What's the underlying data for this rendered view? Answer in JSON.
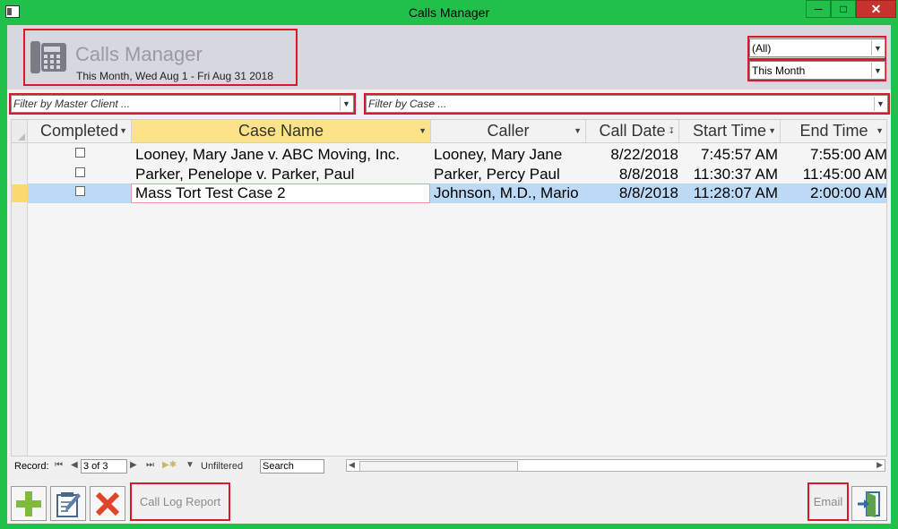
{
  "window": {
    "title": "Calls Manager",
    "minimize_icon": "minimize-icon",
    "maximize_icon": "maximize-icon",
    "close_icon": "close-icon"
  },
  "header": {
    "title": "Calls Manager",
    "subtitle": "This Month, Wed Aug 1 - Fri Aug 31 2018",
    "icon": "phone-icon",
    "status_filter": "(All)",
    "period_filter": "This Month"
  },
  "filters": {
    "master_client_placeholder": "Filter by Master Client ...",
    "case_placeholder": "Filter by Case ..."
  },
  "table": {
    "columns": [
      "Completed",
      "Case Name",
      "Caller",
      "Call Date",
      "Start Time",
      "End Time"
    ],
    "rows": [
      {
        "completed": false,
        "case_name": "Looney, Mary Jane v. ABC Moving, Inc.",
        "caller": "Looney, Mary  Jane",
        "call_date": "8/22/2018",
        "start_time": "7:45:57 AM",
        "end_time": "7:55:00 AM"
      },
      {
        "completed": false,
        "case_name": "Parker, Penelope v. Parker, Paul",
        "caller": "Parker, Percy Paul",
        "call_date": "8/8/2018",
        "start_time": "11:30:37 AM",
        "end_time": "11:45:00 AM"
      },
      {
        "completed": false,
        "case_name": "Mass Tort Test Case 2",
        "caller": "Johnson, M.D., Mario",
        "call_date": "8/8/2018",
        "start_time": "11:28:07 AM",
        "end_time": "2:00:00 AM"
      }
    ]
  },
  "navigation": {
    "record_label": "Record:",
    "record_position": "3 of 3",
    "filter_status": "Unfiltered",
    "search_label": "Search"
  },
  "footer": {
    "add_icon": "plus-icon",
    "edit_icon": "edit-form-icon",
    "delete_icon": "delete-x-icon",
    "call_log_report": "Call Log Report",
    "email": "Email",
    "exit_icon": "exit-door-icon"
  },
  "colors": {
    "accent_green": "#20c04a",
    "highlight_red": "#d9182c",
    "selected_row": "#bcd9f5",
    "sorted_header": "#fce38a"
  }
}
